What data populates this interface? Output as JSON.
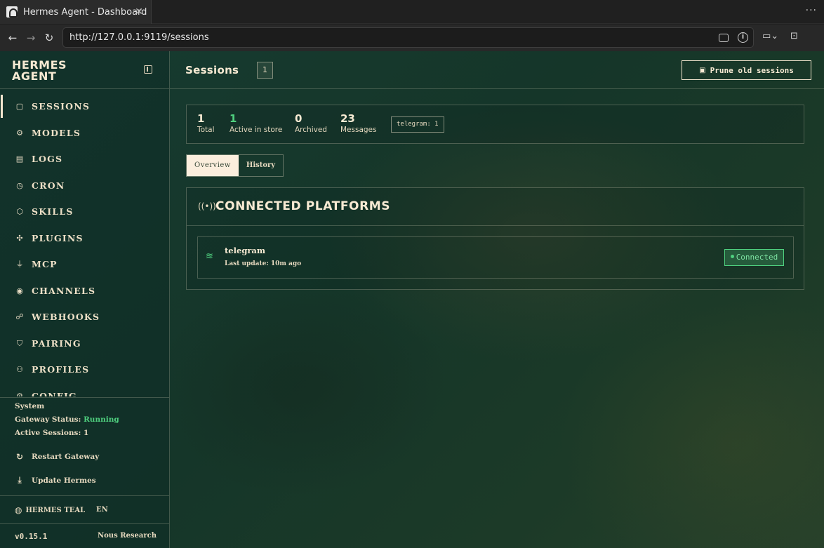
{
  "browser": {
    "tab_title": "Hermes Agent - Dashboard",
    "tab_close": "✕",
    "tab_menu": "···",
    "url": "http://127.0.0.1:9119/sessions"
  },
  "sidebar": {
    "brand_line1": "HERMES",
    "brand_line2": "AGENT",
    "items": [
      {
        "label": "SESSIONS",
        "icon": "message-icon",
        "glyph": "▢",
        "active": true
      },
      {
        "label": "MODELS",
        "icon": "chip-icon",
        "glyph": "⚙"
      },
      {
        "label": "LOGS",
        "icon": "file-icon",
        "glyph": "▤"
      },
      {
        "label": "CRON",
        "icon": "clock-icon",
        "glyph": "◷"
      },
      {
        "label": "SKILLS",
        "icon": "cube-icon",
        "glyph": "⬡"
      },
      {
        "label": "PLUGINS",
        "icon": "puzzle-icon",
        "glyph": "✣"
      },
      {
        "label": "MCP",
        "icon": "plug-icon",
        "glyph": "⏚"
      },
      {
        "label": "CHANNELS",
        "icon": "broadcast-icon",
        "glyph": "◉"
      },
      {
        "label": "WEBHOOKS",
        "icon": "webhook-icon",
        "glyph": "☍"
      },
      {
        "label": "PAIRING",
        "icon": "shield-icon",
        "glyph": "⛉"
      },
      {
        "label": "PROFILES",
        "icon": "users-icon",
        "glyph": "⚇"
      },
      {
        "label": "CONFIG",
        "icon": "settings-icon",
        "glyph": "⚙"
      }
    ],
    "system": {
      "title": "System",
      "gateway_label": "Gateway Status: ",
      "gateway_value": "Running",
      "sessions_line": "Active Sessions: 1",
      "restart_label": "Restart Gateway",
      "update_label": "Update Hermes"
    },
    "theme_label": "HERMES TEAL",
    "language": "EN",
    "version": "v0.15.1",
    "vendor": "Nous Research"
  },
  "header": {
    "title": "Sessions",
    "count": "1",
    "prune_label": "Prune old sessions"
  },
  "stats": [
    {
      "value": "1",
      "label": "Total"
    },
    {
      "value": "1",
      "label": "Active in store"
    },
    {
      "value": "0",
      "label": "Archived"
    },
    {
      "value": "23",
      "label": "Messages"
    }
  ],
  "platform_chip": "telegram: 1",
  "tabs": [
    {
      "label": "Overview",
      "active": true
    },
    {
      "label": "History",
      "active": false
    }
  ],
  "connected": {
    "title": "CONNECTED PLATFORMS",
    "platform_name": "telegram",
    "last_update": "Last update: 10m ago",
    "status": "Connected"
  },
  "colors": {
    "accent_green": "#4fd07f",
    "text_cream": "#f3e6cf",
    "background": "#153629"
  }
}
